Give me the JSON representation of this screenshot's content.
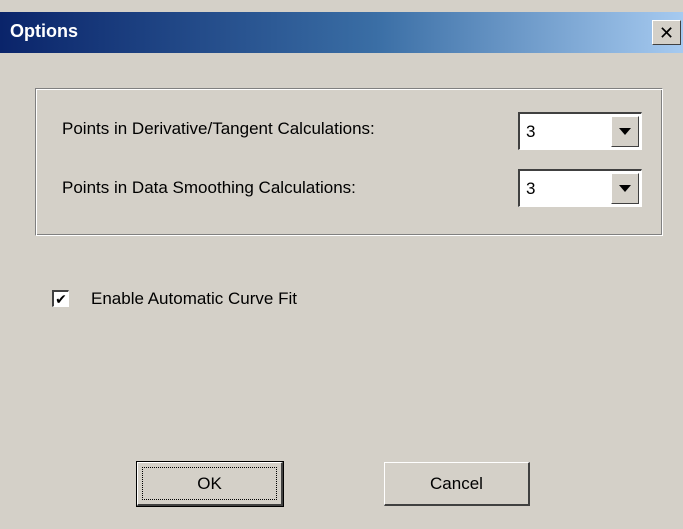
{
  "window": {
    "title": "Options",
    "close_glyph": "✕",
    "close_icon": "close-icon"
  },
  "settings": {
    "derivative_label": "Points in Derivative/Tangent Calculations:",
    "derivative_value": "3",
    "smoothing_label": "Points in Data Smoothing Calculations:",
    "smoothing_value": "3"
  },
  "curve_fit": {
    "label": "Enable Automatic Curve Fit",
    "checked": true,
    "check_glyph": "✔"
  },
  "buttons": {
    "ok_label": "OK",
    "cancel_label": "Cancel"
  }
}
